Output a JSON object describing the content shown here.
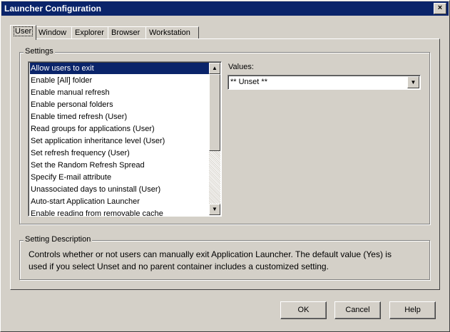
{
  "window": {
    "title": "Launcher Configuration",
    "close_glyph": "×"
  },
  "tabs": [
    {
      "label": "User"
    },
    {
      "label": "Window"
    },
    {
      "label": "Explorer"
    },
    {
      "label": "Browser"
    },
    {
      "label": "Workstation"
    }
  ],
  "settings": {
    "group_label": "Settings",
    "items": [
      "Allow users to exit",
      "Enable [All] folder",
      "Enable manual refresh",
      "Enable personal folders",
      "Enable timed refresh (User)",
      "Read groups for applications (User)",
      "Set application inheritance level (User)",
      "Set refresh frequency (User)",
      "Set the Random Refresh Spread",
      "Specify E-mail attribute",
      "Unassociated days to uninstall (User)",
      "Auto-start Application Launcher",
      "Enable reading from removable cache"
    ],
    "selected_index": 0,
    "scroll_up_glyph": "▲",
    "scroll_down_glyph": "▼"
  },
  "values": {
    "label": "Values:",
    "selected": "** Unset **",
    "dropdown_glyph": "▼"
  },
  "description": {
    "group_label": "Setting Description",
    "line1": "Controls whether or not users can manually exit Application Launcher. The default value (Yes) is",
    "line2": "used if you select Unset and no parent container includes a customized setting."
  },
  "buttons": {
    "ok": "OK",
    "cancel": "Cancel",
    "help": "Help"
  }
}
